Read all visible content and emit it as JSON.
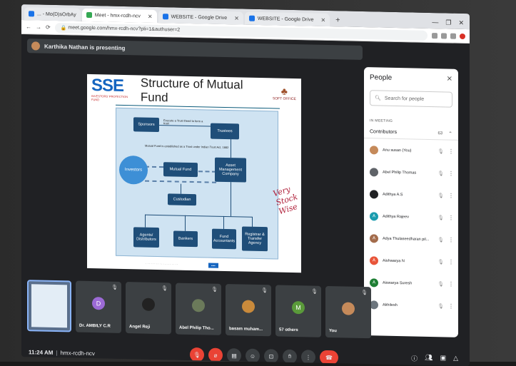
{
  "browser": {
    "tabs": [
      {
        "label": "... - Mo(D)sOrbAy",
        "active": false
      },
      {
        "label": "Meet - hmx-rcdh-ncv",
        "active": true
      },
      {
        "label": "WEBSITE - Google Drive",
        "active": false
      },
      {
        "label": "WEBSITE - Google Drive",
        "active": false
      }
    ],
    "new_tab": "+",
    "url": "meet.google.com/hmx-rcdh-ncv?pli=1&authuser=2"
  },
  "presenter_banner": "Karthika Nathan is presenting",
  "slide": {
    "brand": "SSE",
    "brand_sub": "INVESTORS' PROTECTION FUND",
    "title": "Structure of Mutual Fund",
    "logo_text": "SOFT OFFICE",
    "nodes": {
      "sponsors": "Sponsors",
      "trustees": "Trustees",
      "investors": "Investors",
      "mutual_fund": "Mutual Fund",
      "amc": "Asset Management Company",
      "custodian": "Custodian",
      "agents": "Agents/ Distributors",
      "bankers": "Bankers",
      "fund_accountants": "Fund Accountants",
      "registrar": "Registrar & Transfer Agency"
    },
    "notes": {
      "trust_deed": "Execute a Trust Deed to form a trust",
      "established": "Mutual Fund is established as a Trust under Indian Trust Act, 1882"
    },
    "handwriting": "Very Stock Wise"
  },
  "people": {
    "title": "People",
    "search_placeholder": "Search for people",
    "section": "IN MEETING",
    "group": "Contributors",
    "count": "63",
    "members": [
      {
        "name": "Anu susan (You)",
        "color": "#c58a5a"
      },
      {
        "name": "Abel Philip Thomas",
        "color": "#5f6368"
      },
      {
        "name": "Adithya A.S",
        "color": "#202124"
      },
      {
        "name": "Adithya Rajeev",
        "color": "#1a9cae",
        "initial": "A"
      },
      {
        "name": "Adya Thulaseedharan pil...",
        "color": "#a36c4c",
        "initial": "A"
      },
      {
        "name": "Aishwarya N",
        "color": "#e8553a",
        "initial": "A"
      },
      {
        "name": "Aiswarya Suresh",
        "color": "#1e7e34",
        "initial": "A"
      },
      {
        "name": "Akhilesh",
        "color": "#6c757d"
      }
    ]
  },
  "tiles": [
    {
      "name": "Dr. AMBILY C.R",
      "initial": "D",
      "color": "#9c6ad6"
    },
    {
      "name": "Angel Reji",
      "initial": "",
      "color": "#222"
    },
    {
      "name": "Abel Philip Tho...",
      "initial": "",
      "color": "#6b7a5a"
    },
    {
      "name": "basam muham...",
      "initial": "",
      "color": "#c98a3b"
    },
    {
      "name": "57 others",
      "initial": "M",
      "color": "#5a9a3a"
    },
    {
      "name": "You",
      "initial": "",
      "color": "#c58a5a"
    }
  ],
  "bottom": {
    "time": "11:24 AM",
    "separator": "|",
    "meeting_code": "hmx-rcdh-ncv"
  }
}
